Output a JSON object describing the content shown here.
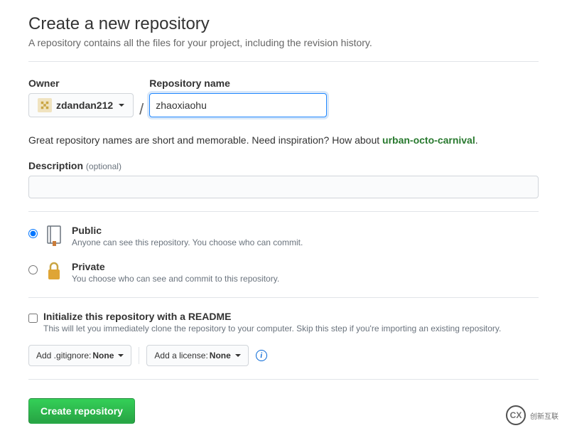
{
  "header": {
    "title": "Create a new repository",
    "subtitle": "A repository contains all the files for your project, including the revision history."
  },
  "owner": {
    "label": "Owner",
    "username": "zdandan212"
  },
  "repo": {
    "label": "Repository name",
    "value": "zhaoxiaohu"
  },
  "hint": {
    "prefix": "Great repository names are short and memorable. Need inspiration? How about ",
    "suggestion": "urban-octo-carnival",
    "suffix": "."
  },
  "description": {
    "label": "Description",
    "optional": "(optional)",
    "value": ""
  },
  "visibility": {
    "public": {
      "title": "Public",
      "desc": "Anyone can see this repository. You choose who can commit."
    },
    "private": {
      "title": "Private",
      "desc": "You choose who can see and commit to this repository."
    }
  },
  "readme": {
    "title": "Initialize this repository with a README",
    "desc": "This will let you immediately clone the repository to your computer. Skip this step if you're importing an existing repository."
  },
  "dropdowns": {
    "gitignore_prefix": "Add .gitignore: ",
    "gitignore_value": "None",
    "license_prefix": "Add a license: ",
    "license_value": "None"
  },
  "submit": {
    "label": "Create repository"
  },
  "watermark": {
    "text": "创新互联"
  }
}
